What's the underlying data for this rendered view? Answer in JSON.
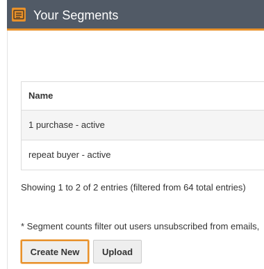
{
  "header": {
    "title": "Your Segments",
    "icon": "list-icon",
    "background": "#515a66",
    "accent": "#e8912b"
  },
  "table": {
    "columns": [
      "Name"
    ],
    "rows": [
      {
        "name": "1 purchase - active"
      },
      {
        "name": "repeat buyer - active"
      }
    ]
  },
  "info_text": "Showing 1 to 2 of 2 entries (filtered from 64 total entries)",
  "footnote": "* Segment counts filter out users unsubscribed from emails,",
  "buttons": {
    "create_new": "Create New",
    "upload": "Upload"
  }
}
